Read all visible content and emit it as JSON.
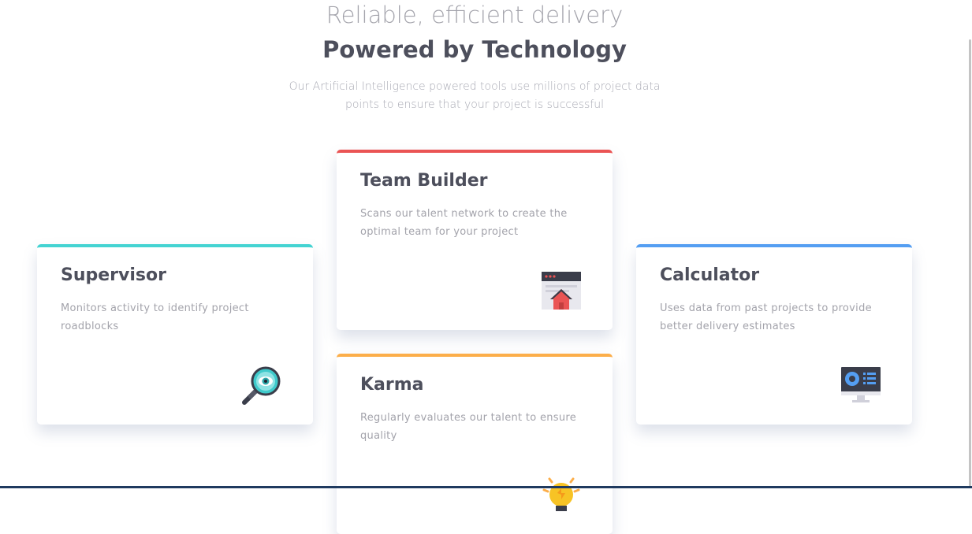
{
  "hero": {
    "subtitle": "Reliable, efficient delivery",
    "title": "Powered by Technology",
    "description": "Our Artificial Intelligence powered tools use millions of project data points to ensure that your project is successful"
  },
  "cards": {
    "supervisor": {
      "title": "Supervisor",
      "description": "Monitors activity to identify project roadblocks",
      "icon": "magnifier-eye-icon",
      "accent": "#44d3d2"
    },
    "team_builder": {
      "title": "Team Builder",
      "description": "Scans our talent network to create the optimal team for your project",
      "icon": "browser-house-icon",
      "accent": "#ea5454"
    },
    "karma": {
      "title": "Karma",
      "description": "Regularly evaluates our talent to ensure quality",
      "icon": "lightbulb-icon",
      "accent": "#fcae4a"
    },
    "calculator": {
      "title": "Calculator",
      "description": "Uses data from past projects to provide better delivery estimates",
      "icon": "monitor-chart-icon",
      "accent": "#549ef2"
    }
  }
}
